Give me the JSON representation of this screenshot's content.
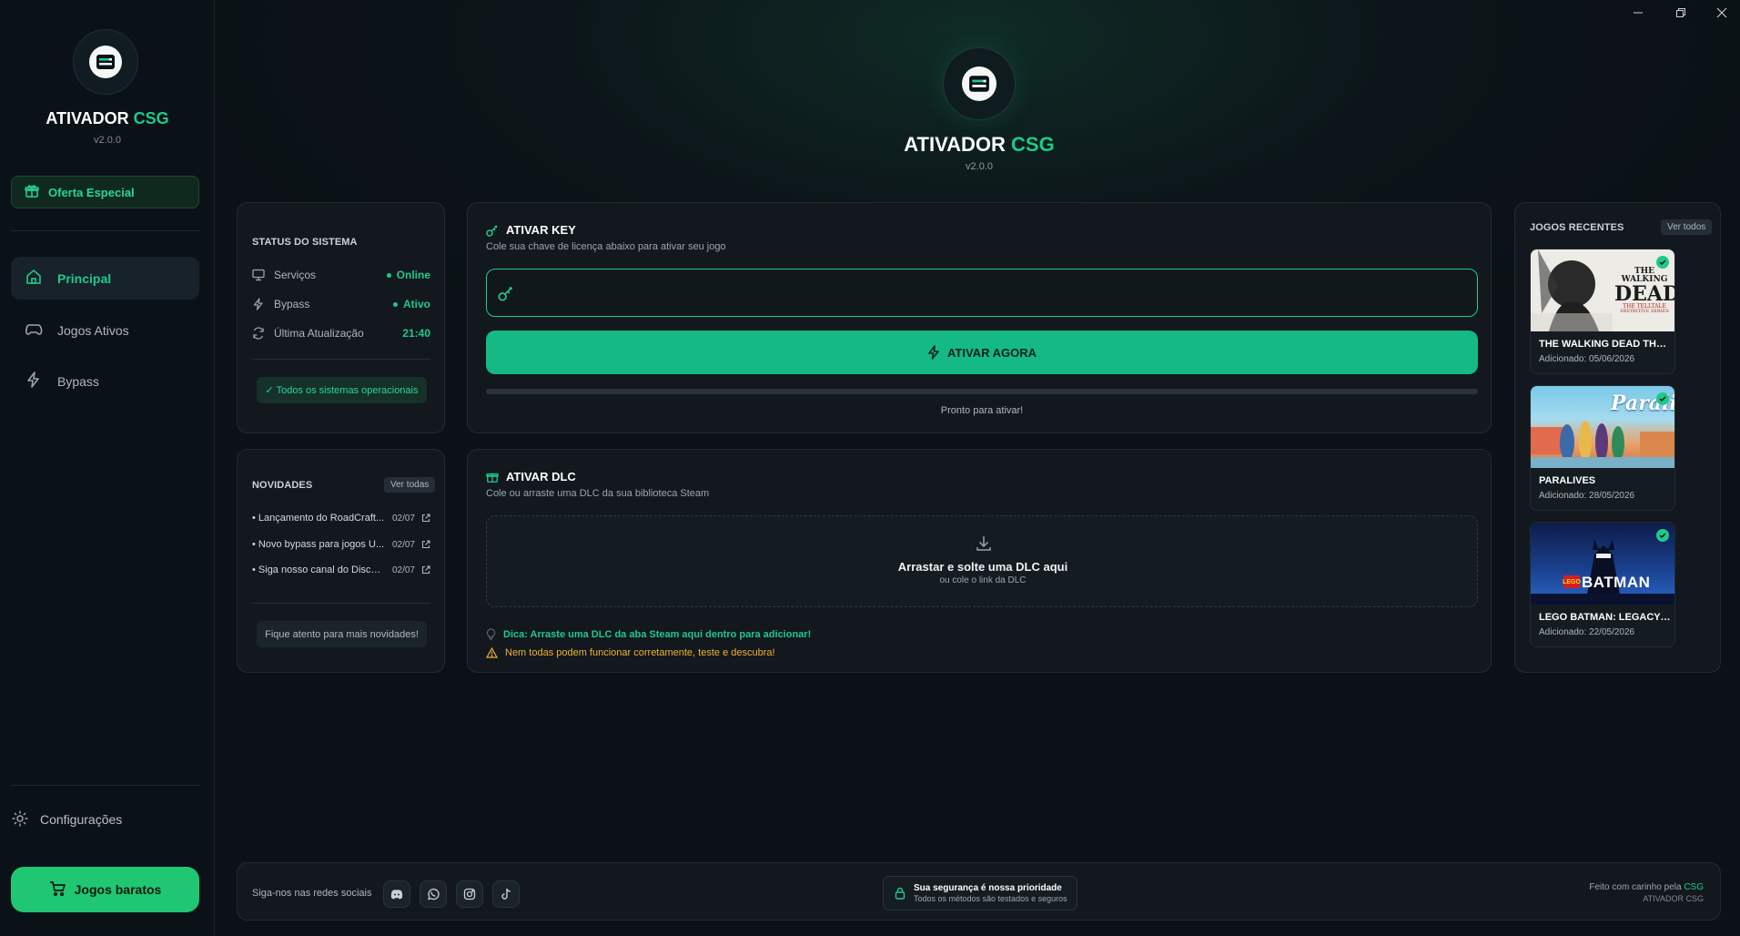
{
  "app": {
    "name_part1": "ATIVADOR",
    "name_part2": "CSG",
    "version": "v2.0.0",
    "accent_color": "#1fc98b"
  },
  "sidebar": {
    "offer_label": "Oferta Especial",
    "nav": [
      {
        "label": "Principal",
        "icon": "home-icon",
        "active": true
      },
      {
        "label": "Jogos Ativos",
        "icon": "gamepad-icon",
        "active": false
      },
      {
        "label": "Bypass",
        "icon": "bolt-icon",
        "active": false
      }
    ],
    "settings_label": "Configurações",
    "cheap_games_label": "Jogos baratos"
  },
  "window_controls": [
    "minimize",
    "maximize",
    "close"
  ],
  "status": {
    "title": "STATUS DO SISTEMA",
    "rows": [
      {
        "label": "Serviços",
        "value": "Online",
        "icon": "monitor-icon"
      },
      {
        "label": "Bypass",
        "value": "Ativo",
        "icon": "bolt-icon"
      },
      {
        "label": "Última Atualização",
        "value": "21:40",
        "icon": "refresh-icon"
      }
    ],
    "footer_pill": "✓ Todos os sistemas operacionais"
  },
  "news": {
    "title": "NOVIDADES",
    "see_all": "Ver todas",
    "items": [
      {
        "text": "• Lançamento do RoadCraft...",
        "date": "02/07"
      },
      {
        "text": "• Novo bypass para jogos U...",
        "date": "02/07"
      },
      {
        "text": "• Siga nosso canal do Discor...",
        "date": "02/07"
      }
    ],
    "footer_pill": "Fique atento para mais novidades!"
  },
  "activate_key": {
    "title": "ATIVAR KEY",
    "subtitle": "Cole sua chave de licença abaixo para ativar seu jogo",
    "input_value": "",
    "input_placeholder": "",
    "button_label": "ATIVAR AGORA",
    "progress": 0,
    "status_text": "Pronto para ativar!"
  },
  "activate_dlc": {
    "title": "ATIVAR DLC",
    "subtitle": "Cole ou arraste uma DLC da sua biblioteca Steam",
    "drop_title": "Arrastar e solte uma DLC aqui",
    "drop_subtitle": "ou cole o link da DLC",
    "tip": "Dica: Arraste uma DLC da aba Steam aqui dentro para adicionar!",
    "warning": "Nem todas podem funcionar corretamente, teste e descubra!"
  },
  "recent_games": {
    "title": "JOGOS RECENTES",
    "see_all": "Ver todos",
    "games": [
      {
        "title": "THE WALKING DEAD THE TELL...",
        "date": "Adicionado: 05/06/2026",
        "art_line1": "THE WALKING",
        "art_line2": "DEAD",
        "art_line3": "THE TELLTALE",
        "art_line4": "DEFINITIVE SERIES"
      },
      {
        "title": "PARALIVES",
        "date": "Adicionado: 28/05/2026",
        "art_line1": "Paralives"
      },
      {
        "title": "LEGO BATMAN: LEGACY OF TH...",
        "date": "Adicionado: 22/05/2026",
        "art_line1": "LEGO",
        "art_line2": "BATMAN"
      }
    ]
  },
  "footer": {
    "social_label": "Siga-nos nas redes sociais",
    "social": [
      "discord-icon",
      "whatsapp-icon",
      "instagram-icon",
      "tiktok-icon"
    ],
    "security_title": "Sua segurança é nossa prioridade",
    "security_sub": "Todos os métodos são testados e seguros",
    "made_by": "Feito com carinho pela",
    "made_by_brand": "CSG",
    "made_by_sub": "ATIVADOR CSG"
  }
}
